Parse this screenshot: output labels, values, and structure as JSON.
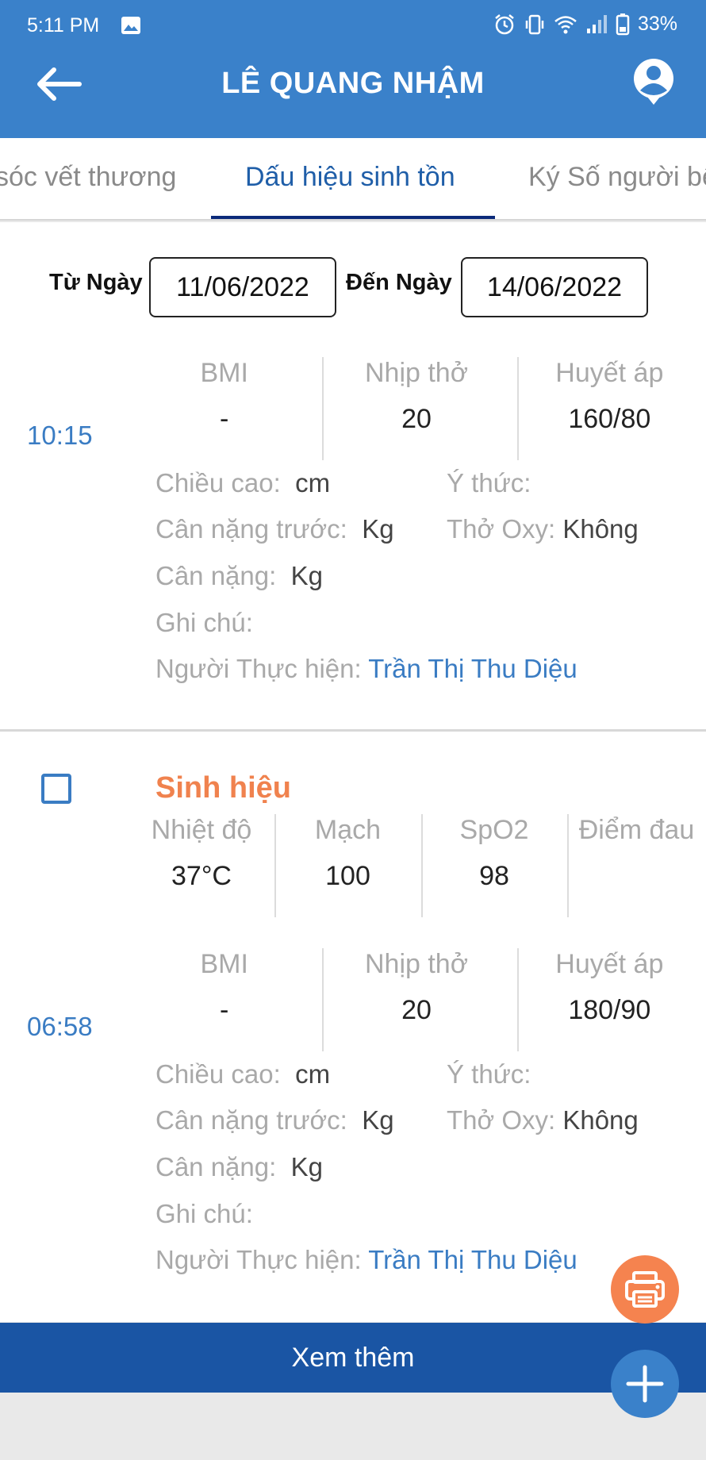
{
  "status_bar": {
    "time": "5:11 PM",
    "battery": "33%"
  },
  "header": {
    "title": "LÊ QUANG NHẬM"
  },
  "tabs": [
    {
      "label": "sóc vết thương"
    },
    {
      "label": "Dấu hiệu sinh tồn",
      "active": true
    },
    {
      "label": "Ký Số người bệ"
    }
  ],
  "filter": {
    "from_label": "Từ Ngày",
    "from_value": "11/06/2022",
    "to_label": "Đến Ngày",
    "to_value": "14/06/2022"
  },
  "labels": {
    "bmi": "BMI",
    "nhip_tho": "Nhịp thở",
    "huyet_ap": "Huyết áp",
    "nhiet_do": "Nhiệt độ",
    "mach": "Mạch",
    "spo2": "SpO2",
    "diem_dau": "Điểm đau",
    "chieu_cao": "Chiều cao:",
    "y_thuc": "Ý thức:",
    "can_nang_truoc": "Cân nặng trước:",
    "tho_oxy": "Thở Oxy:",
    "can_nang": "Cân nặng:",
    "ghi_chu": "Ghi chú:",
    "nguoi_thuc_hien": "Người Thực hiện:"
  },
  "records": [
    {
      "time": "10:15",
      "bmi": "-",
      "nhip_tho": "20",
      "huyet_ap": "160/80",
      "chieu_cao": "cm",
      "can_nang_truoc": "Kg",
      "can_nang": "Kg",
      "tho_oxy": "Không",
      "nguoi_thuc_hien": "Trần Thị Thu Diệu"
    },
    {
      "time": "06:58",
      "heading": "Sinh hiệu",
      "nhiet_do": "37°C",
      "mach": "100",
      "spo2": "98",
      "bmi": "-",
      "nhip_tho": "20",
      "huyet_ap": "180/90",
      "chieu_cao": "cm",
      "can_nang_truoc": "Kg",
      "can_nang": "Kg",
      "tho_oxy": "Không",
      "nguoi_thuc_hien": "Trần Thị Thu Diệu"
    }
  ],
  "footer": {
    "more_label": "Xem thêm"
  },
  "colors": {
    "primary": "#3a81ca",
    "accent": "#f5834f",
    "link": "#3a7cc3",
    "footer": "#1a55a4"
  },
  "icons": [
    "image-icon",
    "alarm-icon",
    "vibrate-icon",
    "wifi-icon",
    "signal-icon",
    "battery-icon",
    "back-arrow-icon",
    "profile-icon",
    "print-icon",
    "plus-icon"
  ]
}
